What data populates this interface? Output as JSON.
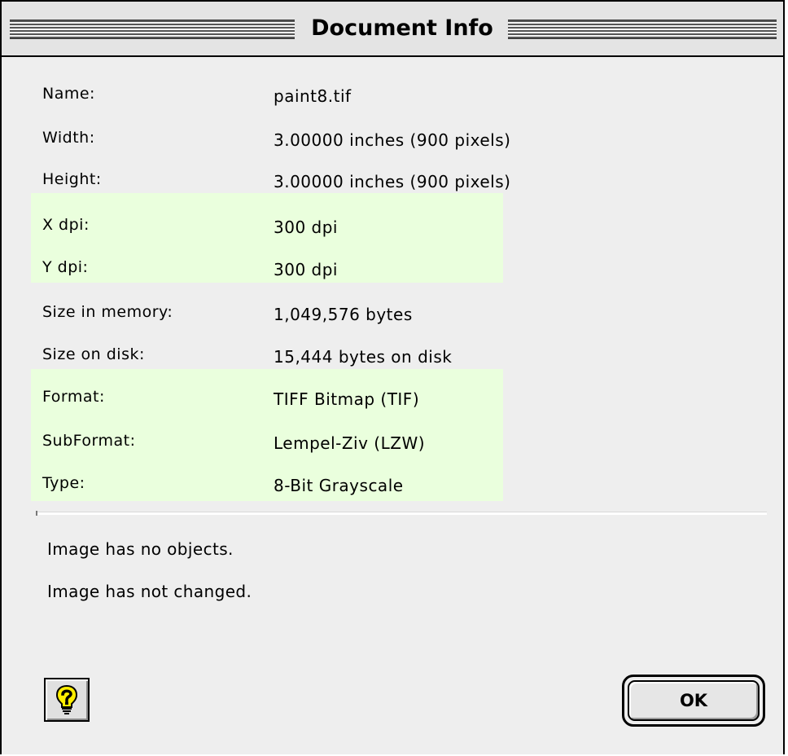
{
  "window": {
    "title": "Document Info"
  },
  "info": {
    "rows": [
      {
        "label": "Name:",
        "value": "paint8.tif"
      },
      {
        "label": "Width:",
        "value": "3.00000 inches  (900 pixels)"
      },
      {
        "label": "Height:",
        "value": "3.00000 inches  (900 pixels)"
      },
      {
        "label": "X dpi:",
        "value": "300 dpi"
      },
      {
        "label": "Y dpi:",
        "value": "300 dpi"
      },
      {
        "label": "Size in memory:",
        "value": "1,049,576 bytes"
      },
      {
        "label": "Size on disk:",
        "value": "15,444 bytes on disk"
      },
      {
        "label": "Format:",
        "value": "TIFF Bitmap (TIF)"
      },
      {
        "label": "SubFormat:",
        "value": "Lempel-Ziv (LZW)"
      },
      {
        "label": "Type:",
        "value": "8-Bit Grayscale"
      }
    ]
  },
  "status": {
    "objects": "Image has no objects.",
    "changed": "Image has not changed."
  },
  "buttons": {
    "ok_label": "OK",
    "help_icon": "lightbulb-question-icon"
  },
  "colors": {
    "highlight": "#eaffdd",
    "window_bg": "#eeeeee"
  }
}
